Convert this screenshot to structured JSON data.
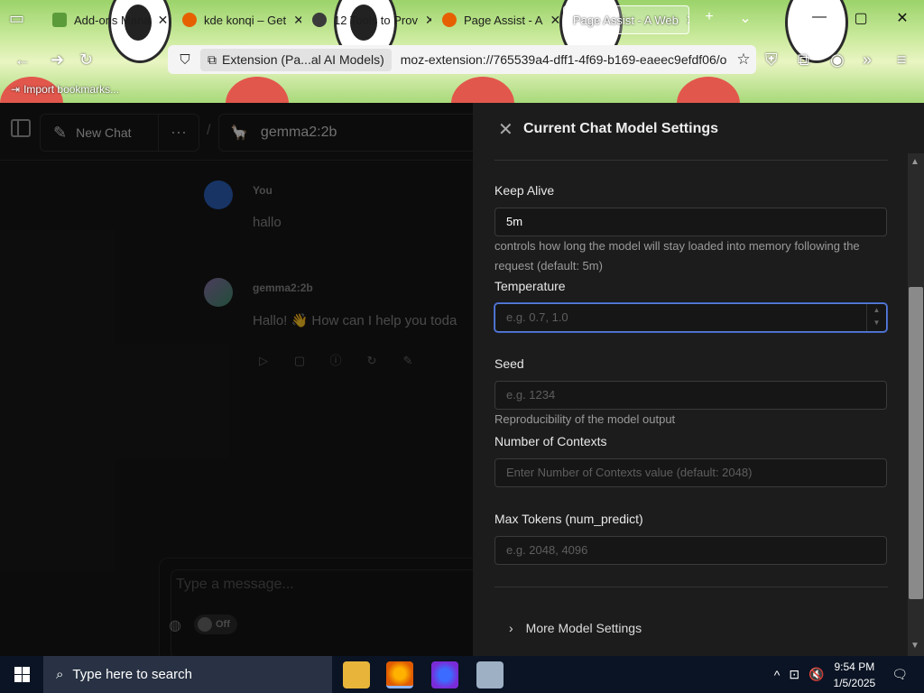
{
  "browser": {
    "tabs": [
      {
        "label": "Add-ons Mana",
        "close": "✕"
      },
      {
        "label": "kde konqi – Get",
        "close": "✕"
      },
      {
        "label": "12 Tools to Prov",
        "close": "✕"
      },
      {
        "label": "Page Assist - A",
        "close": "✕"
      },
      {
        "label": "Page Assist - A Web",
        "close": "✕"
      }
    ],
    "new_tab": "+",
    "url_chip": "Extension (Pa...al AI Models)",
    "url": "moz-extension://765539a4-dff1-4f69-b169-eaeec9efdf06/o",
    "bookmark": "Import bookmarks..."
  },
  "app": {
    "new_chat_label": "New Chat",
    "more_label": "···",
    "slash": "/",
    "model_name": "gemma2:2b",
    "messages": [
      {
        "sender": "You",
        "text": "hallo"
      },
      {
        "sender": "gemma2:2b",
        "text": "Hallo! 👋 How can I help you toda"
      }
    ],
    "composer_placeholder": "Type a message...",
    "web_toggle_label": "Off"
  },
  "settings": {
    "title": "Current Chat Model Settings",
    "keep_alive": {
      "label": "Keep Alive",
      "value": "5m",
      "help": "controls how long the model will stay loaded into memory following the request (default: 5m)"
    },
    "temperature": {
      "label": "Temperature",
      "placeholder": "e.g. 0.7, 1.0"
    },
    "seed": {
      "label": "Seed",
      "placeholder": "e.g. 1234",
      "help": "Reproducibility of the model output"
    },
    "num_ctx": {
      "label": "Number of Contexts",
      "placeholder": "Enter Number of Contexts value (default: 2048)"
    },
    "max_tokens": {
      "label": "Max Tokens (num_predict)",
      "placeholder": "e.g. 2048, 4096"
    },
    "more": "More Model Settings"
  },
  "taskbar": {
    "search_placeholder": "Type here to search",
    "time": "9:54 PM",
    "date": "1/5/2025"
  },
  "colors": {
    "accent_focus": "#5b7fd8",
    "drawer_bg": "#1c1c1c",
    "taskbar_bg": "#0a1424"
  }
}
